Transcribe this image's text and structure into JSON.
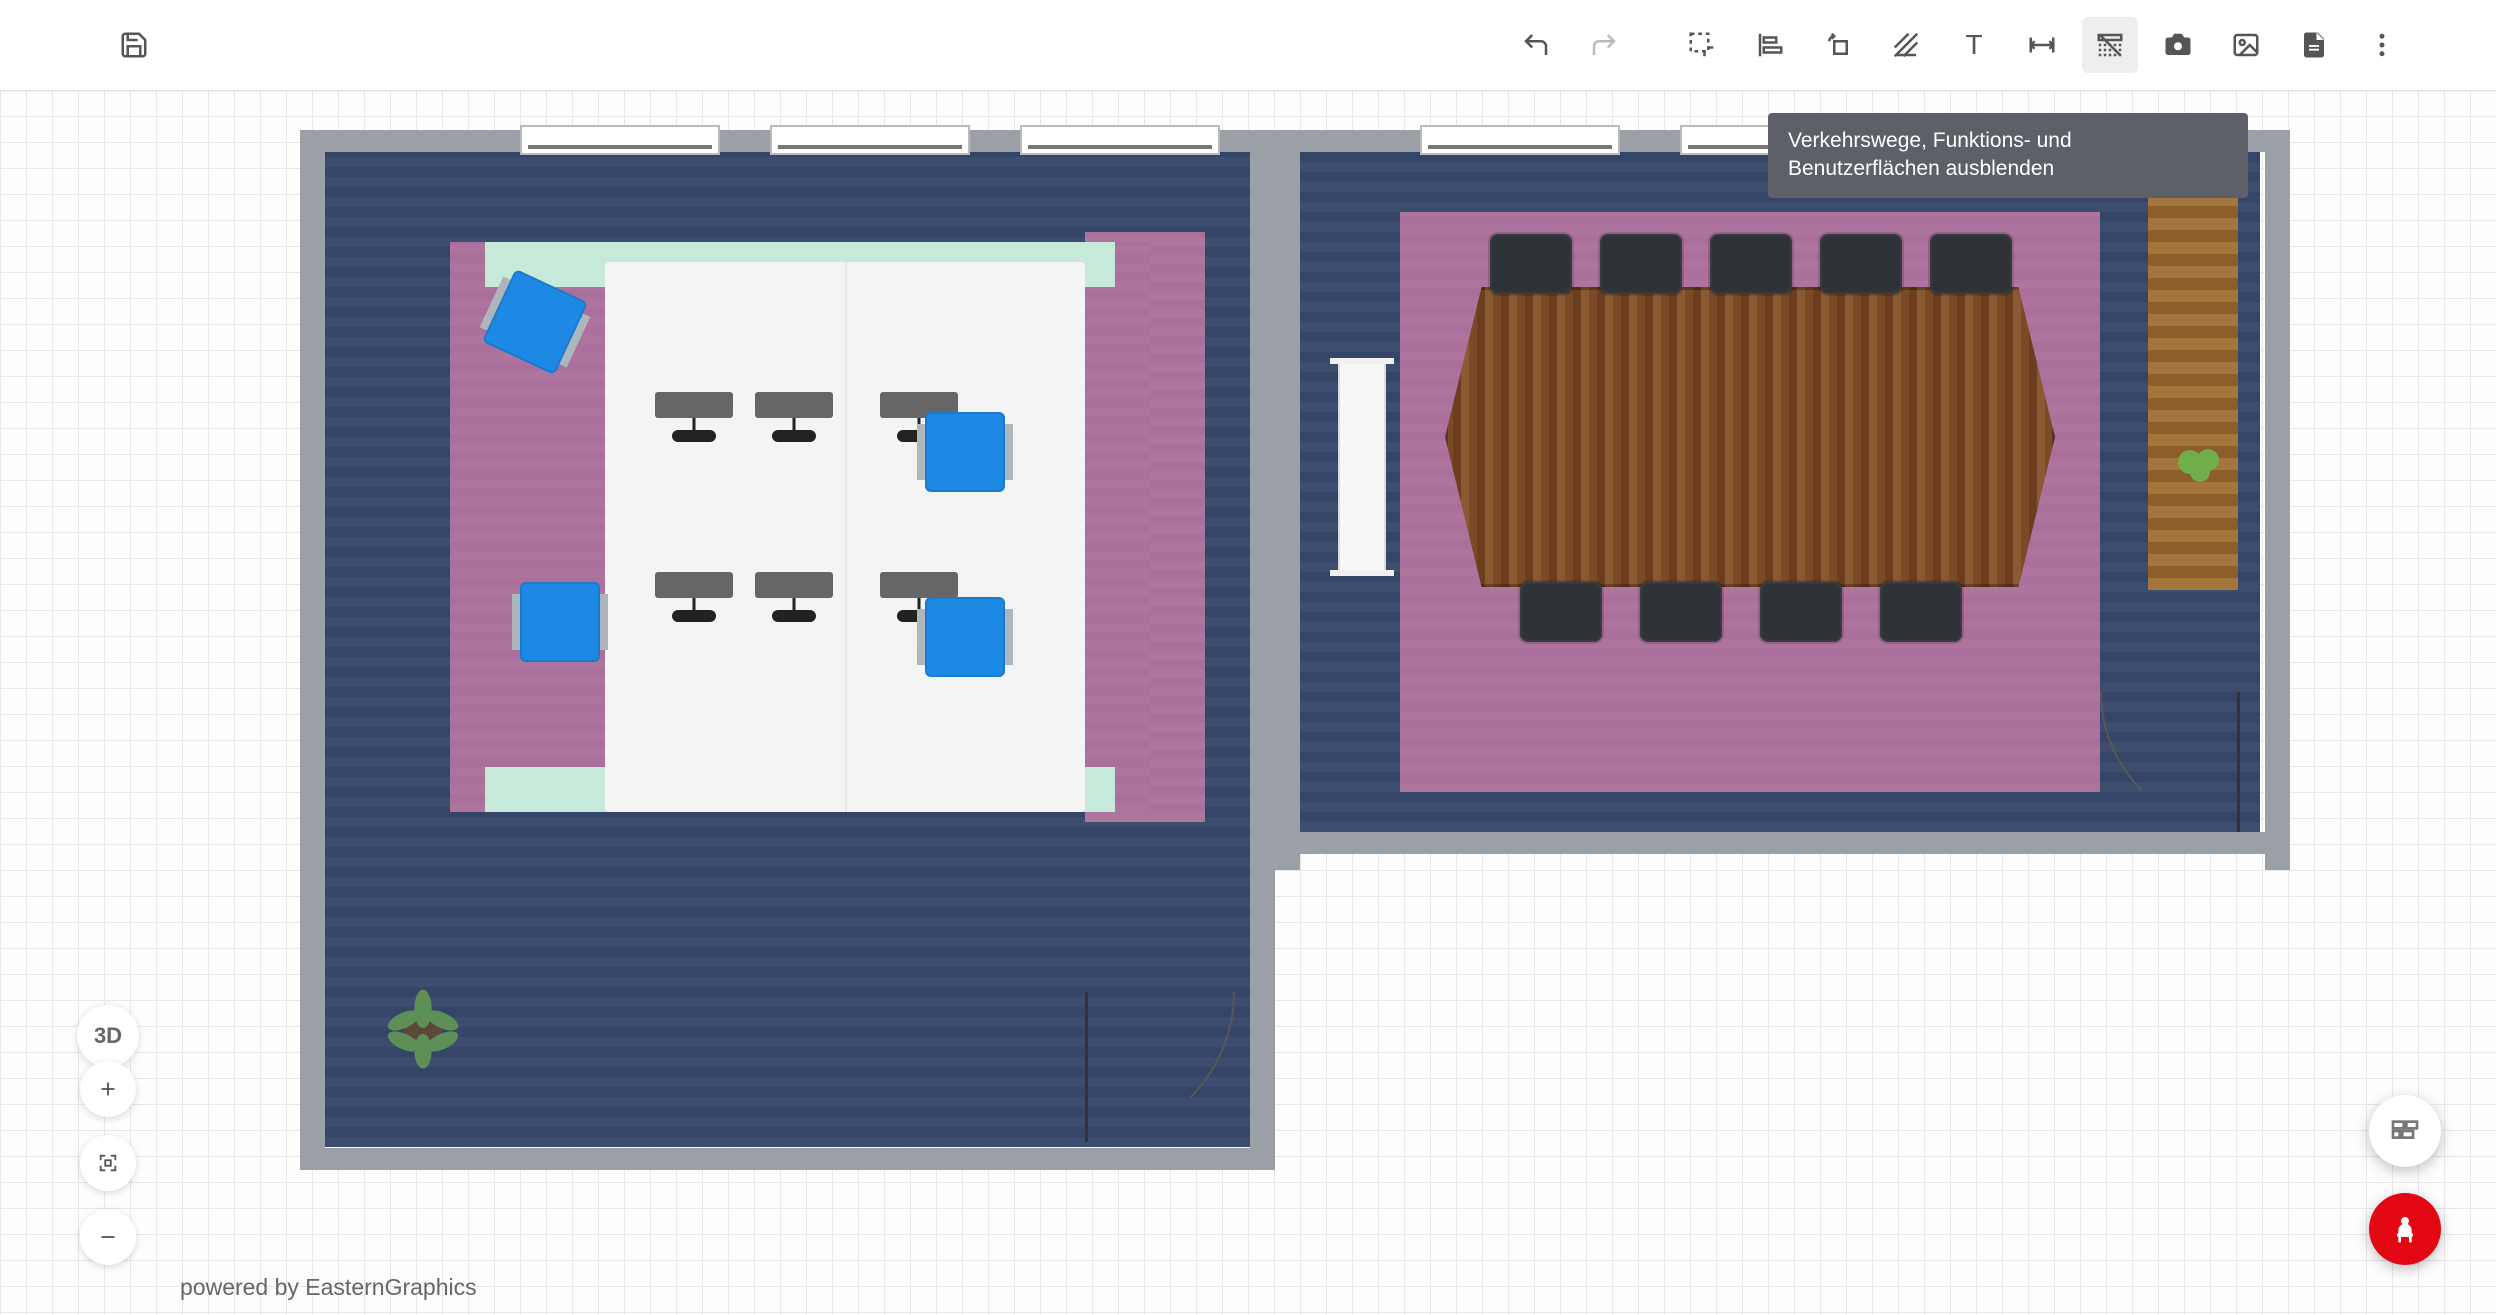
{
  "toolbar": {
    "icons": {
      "save": "save-icon",
      "undo": "undo-icon",
      "redo": "redo-icon",
      "select": "marquee-select-icon",
      "align": "align-icon",
      "rotate": "rotate-icon",
      "measure_area": "hatch-icon",
      "text": "text-icon",
      "dimension": "dimension-icon",
      "toggle_paths": "paths-toggle-icon",
      "camera": "camera-icon",
      "image": "image-icon",
      "document": "document-icon",
      "more": "more-icon"
    },
    "text_tool_label": "T",
    "active_tool": "toggle_paths"
  },
  "tooltip": {
    "text": "Verkehrswege, Funktions- und Benutzerflächen ausblenden"
  },
  "view": {
    "mode_button_label": "3D",
    "zoom_in": "+",
    "zoom_fit": "fit",
    "zoom_out": "−"
  },
  "fab": {
    "wall": "wall-pattern-icon",
    "furniture": "chair-icon"
  },
  "credit": {
    "text": "powered by EasternGraphics"
  },
  "floorplan": {
    "rooms": [
      {
        "id": "office-left",
        "floor": "carpet-blue"
      },
      {
        "id": "meeting-right",
        "floor": "carpet-blue"
      }
    ],
    "zones": [
      "traffic-purple-left",
      "traffic-purple-right",
      "functional-mint"
    ],
    "furniture": {
      "left_room": [
        "desk-cluster",
        "office-chair×3",
        "side-shelf",
        "plant"
      ],
      "right_room": [
        "meeting-table",
        "meeting-chair×8",
        "whiteboard",
        "sideboard",
        "plant"
      ]
    },
    "openings": [
      "window×6",
      "door×2"
    ]
  }
}
